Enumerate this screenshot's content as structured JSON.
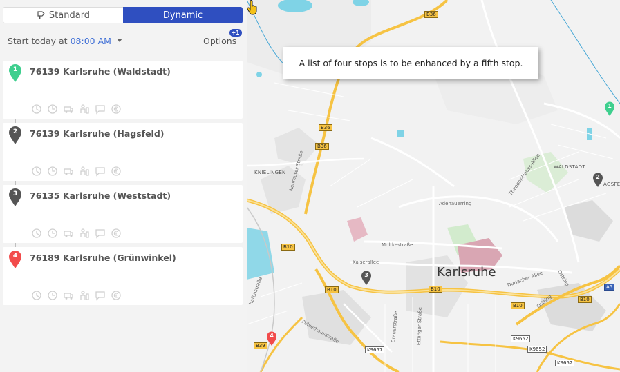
{
  "mode_tabs": {
    "standard_label": "Standard",
    "dynamic_label": "Dynamic",
    "active": "Dynamic"
  },
  "start": {
    "prefix": "Start today at",
    "time": "08:00 AM"
  },
  "options": {
    "label": "Options",
    "badge": "+1"
  },
  "stops": [
    {
      "number": "1",
      "name": "76139 Karlsruhe (Waldstadt)",
      "color": "#3ecf8e"
    },
    {
      "number": "2",
      "name": "76139 Karlsruhe (Hagsfeld)",
      "color": "#555555"
    },
    {
      "number": "3",
      "name": "76135 Karlsruhe (Weststadt)",
      "color": "#555555"
    },
    {
      "number": "4",
      "name": "76189 Karlsruhe (Grünwinkel)",
      "color": "#f24b4b"
    }
  ],
  "stop_action_icons": [
    "timer-icon",
    "clock-icon",
    "vehicle-icon",
    "person-icon",
    "comment-icon",
    "euro-icon"
  ],
  "map": {
    "city": "Karlsruhe",
    "tooltip": "A list of four stops is to be enhanced by a fifth stop.",
    "districts": {
      "knielingen": "KNIELINGEN",
      "waldstadt": "WALDSTADT",
      "hagsfeld_partial": "AGSFELD"
    },
    "streets": {
      "neureuter": "Neureuter Straße",
      "moltke": "Moltkestraße",
      "kaiserallee": "Kaiserallee",
      "adenauerring": "Adenauerring",
      "durlacher": "Durlacher Allee",
      "ostring": "Ostring",
      "pulverhaus": "Pulverhausstraße",
      "brauer": "Brauerstraße",
      "ettlinger": "Ettlinger Straße",
      "theodor": "Theodor-Heuss-Allee",
      "schiffer": "hafenstraße",
      "ostring2": "Ostring"
    },
    "shields": {
      "b36_top": "B36",
      "b36_mid": "B36",
      "b36_low": "B36",
      "b10_left": "B10",
      "b10_mid": "B10",
      "b10_center": "B10",
      "b10_east": "B10",
      "b10_far": "B10",
      "b39": "B39",
      "k9657": "K9657",
      "k9652_a": "K9652",
      "k9652_b": "K9652",
      "k9652_c": "K9652",
      "a5": "A5"
    },
    "pin_labels": [
      "1",
      "2",
      "3",
      "4"
    ],
    "colors": {
      "water": "#7fd3e6",
      "motorway": "#f6c343",
      "park": "#c9e8c3",
      "highlight": "#d9a6b3"
    }
  }
}
